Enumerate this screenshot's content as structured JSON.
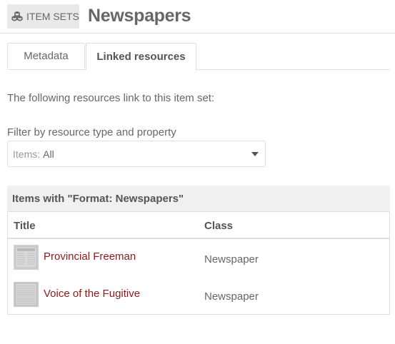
{
  "header": {
    "resource_type": "ITEM SETS",
    "resource_icon": "cubes-icon",
    "title": "Newspapers"
  },
  "tabs": [
    {
      "label": "Metadata",
      "active": false
    },
    {
      "label": "Linked resources",
      "active": true
    }
  ],
  "intro": "The following resources link to this item set:",
  "filter": {
    "label": "Filter by resource type and property",
    "selected_group": "Items",
    "selected_separator": ":",
    "selected_value": "All",
    "caret_icon": "caret-down-icon"
  },
  "section": {
    "heading": "Items with \"Format: Newspapers\""
  },
  "table": {
    "columns": [
      "Title",
      "Class"
    ],
    "rows": [
      {
        "title": "Provincial Freeman",
        "class": "Newspaper",
        "thumbnail_icon": "newspaper-thumbnail"
      },
      {
        "title": "Voice of the Fugitive",
        "class": "Newspaper",
        "thumbnail_icon": "newspaper-thumbnail"
      }
    ]
  },
  "colors": {
    "link": "#8b1a1a",
    "text": "#676767",
    "border": "#dfdfdf",
    "heading_bg": "#f0f0f0",
    "badge_bg": "#e9e9e9"
  }
}
